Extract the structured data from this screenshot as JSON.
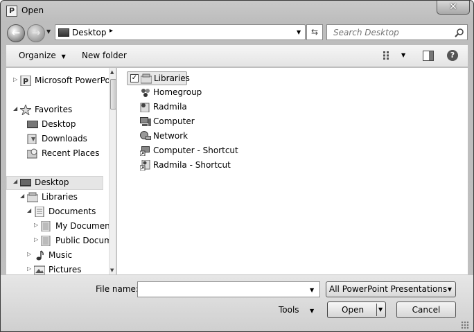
{
  "window": {
    "title": "Open",
    "app_icon_letter": "P"
  },
  "address": {
    "location": "Desktop",
    "separator": "▸",
    "search_placeholder": "Search Desktop"
  },
  "toolbar": {
    "organize_label": "Organize",
    "new_folder_label": "New folder",
    "help": "?"
  },
  "nav_tree": [
    {
      "label": "Microsoft PowerPoint",
      "icon": "powerpoint-icon",
      "arrow": "▷"
    },
    {
      "label": "Favorites",
      "icon": "star-icon",
      "arrow": "◢"
    },
    {
      "label": "Desktop",
      "icon": "desktop-icon"
    },
    {
      "label": "Downloads",
      "icon": "downloads-icon"
    },
    {
      "label": "Recent Places",
      "icon": "recent-places-icon"
    },
    {
      "label": "Desktop",
      "icon": "desktop-icon",
      "arrow": "◢",
      "selected": true
    },
    {
      "label": "Libraries",
      "icon": "libraries-icon",
      "arrow": "◢"
    },
    {
      "label": "Documents",
      "icon": "documents-icon",
      "arrow": "◢"
    },
    {
      "label": "My Documents",
      "icon": "folder-icon",
      "arrow": "▷"
    },
    {
      "label": "Public Documents",
      "icon": "folder-icon",
      "arrow": "▷"
    },
    {
      "label": "Music",
      "icon": "music-icon",
      "arrow": "▷"
    },
    {
      "label": "Pictures",
      "icon": "pictures-icon",
      "arrow": "▷"
    }
  ],
  "files": [
    {
      "label": "Libraries",
      "icon": "libraries-icon",
      "selected": true
    },
    {
      "label": "Homegroup",
      "icon": "homegroup-icon"
    },
    {
      "label": "Radmila",
      "icon": "user-folder-icon"
    },
    {
      "label": "Computer",
      "icon": "computer-icon"
    },
    {
      "label": "Network",
      "icon": "network-icon"
    },
    {
      "label": "Computer - Shortcut",
      "icon": "shortcut-icon"
    },
    {
      "label": "Radmila - Shortcut",
      "icon": "shortcut-icon"
    }
  ],
  "bottom": {
    "file_name_label": "File name:",
    "file_name_value": "",
    "file_type": "All PowerPoint Presentations",
    "tools_label": "Tools",
    "open_label": "Open",
    "cancel_label": "Cancel"
  }
}
